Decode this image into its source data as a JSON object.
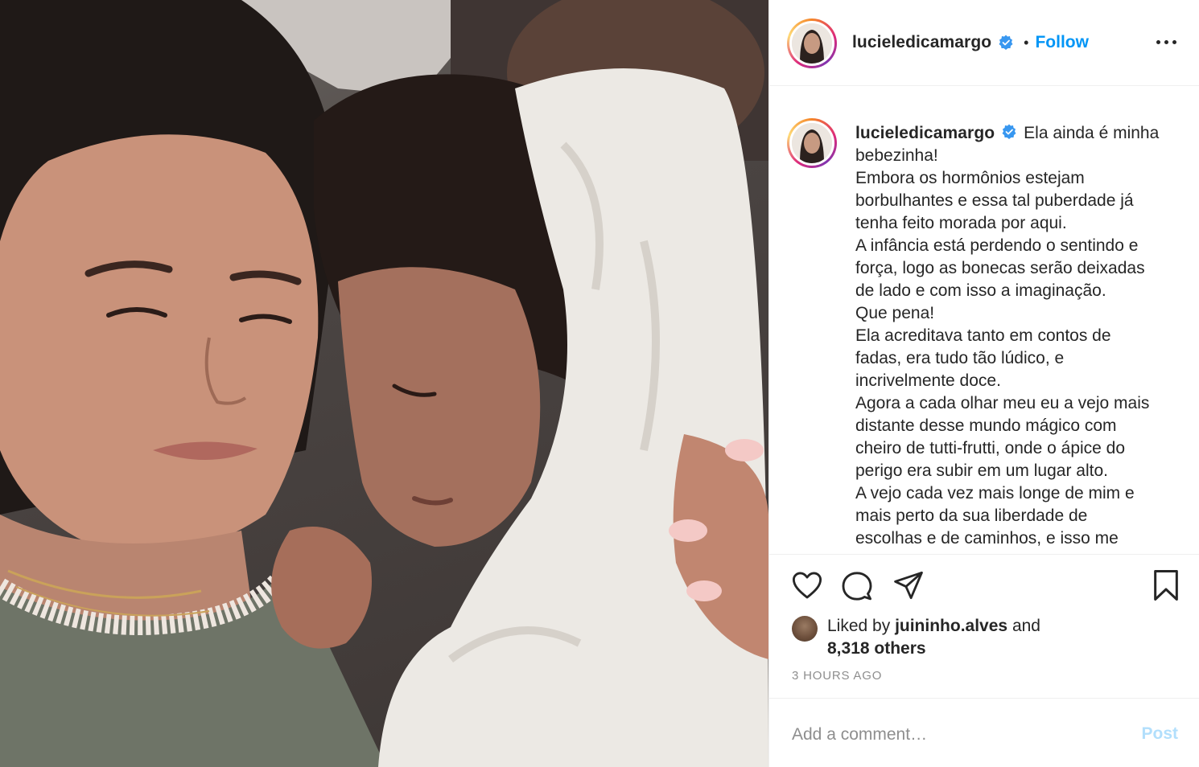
{
  "post": {
    "image_alt": "",
    "author": "lucieledicamargo",
    "follow_label": "Follow",
    "separator": "•",
    "caption": {
      "username": "lucieledicamargo",
      "lines": [
        "Ela ainda é minha",
        "bebezinha!",
        "Embora os hormônios estejam",
        "borbulhantes e essa tal puberdade já",
        "tenha feito morada por aqui.",
        "A infância está perdendo o sentindo e",
        "força, logo as bonecas serão deixadas",
        "de lado e com isso a imaginação.",
        "Que pena!",
        "Ela acreditava tanto em contos de",
        "fadas, era tudo tão lúdico, e",
        "incrivelmente doce.",
        "Agora a cada olhar meu eu a vejo mais",
        "distante desse mundo mágico com",
        "cheiro de tutti-frutti, onde o ápice do",
        "perigo era subir em um lugar alto.",
        "A vejo cada vez mais longe de mim e",
        "mais perto da sua liberdade de",
        "escolhas e de caminhos, e isso me"
      ]
    },
    "likes": {
      "prefix": "Liked by",
      "liker": "juininho.alves",
      "and": "and",
      "others": "8,318 others"
    },
    "timestamp": "3 HOURS AGO",
    "comment_placeholder": "Add a comment…",
    "post_button": "Post"
  },
  "icons": {
    "verified": "verified-badge-icon",
    "more": "more-options-icon",
    "like": "heart-icon",
    "comment": "comment-bubble-icon",
    "share": "paper-plane-icon",
    "save": "bookmark-icon"
  },
  "colors": {
    "link_blue": "#0095f6",
    "post_disabled": "#b2dffc",
    "text": "#262626",
    "muted": "#8e8e8e",
    "divider": "#efefef"
  }
}
